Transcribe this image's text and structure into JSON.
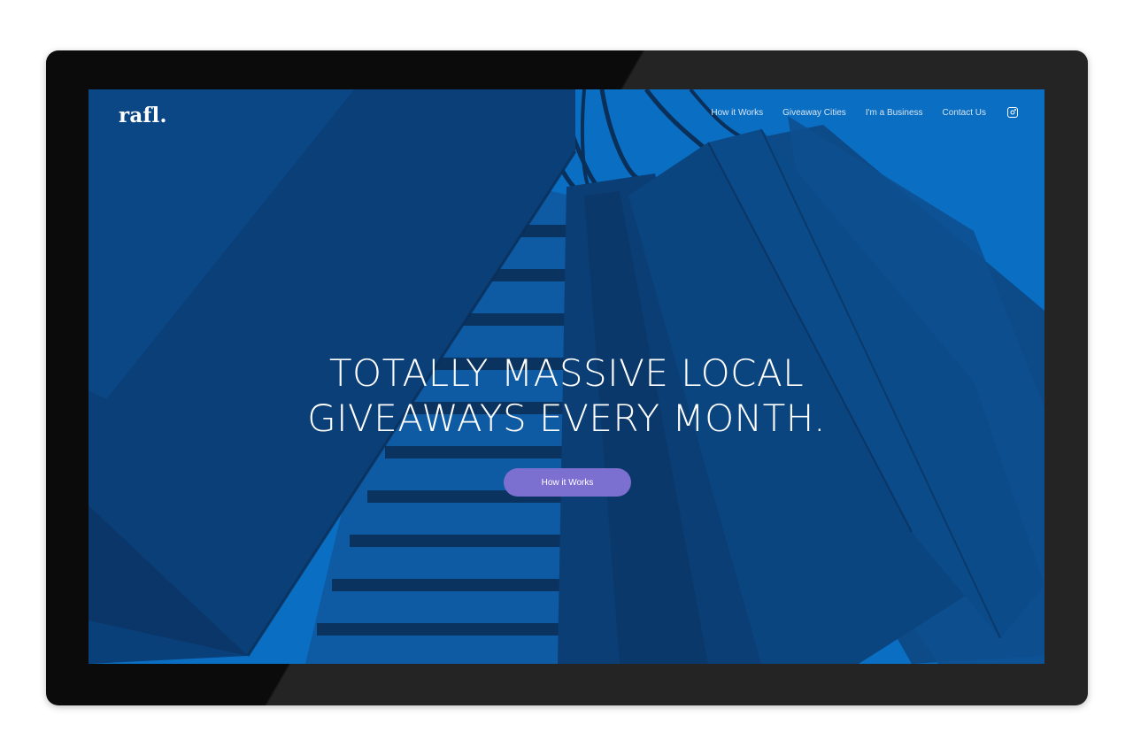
{
  "brand": {
    "logo_text": "rafl."
  },
  "nav": {
    "items": [
      {
        "label": "How it Works"
      },
      {
        "label": "Giveaway Cities"
      },
      {
        "label": "I'm a Business"
      },
      {
        "label": "Contact Us"
      }
    ],
    "social_icon": "instagram-icon"
  },
  "hero": {
    "headline_line1": "TOTALLY MASSIVE LOCAL",
    "headline_line2": "GIVEAWAYS EVERY MONTH.",
    "cta_label": "How it Works",
    "background_description_colors": {
      "base": "#0a6ec2",
      "bag_dark": "#0b3e74",
      "bag_mid": "#0d4f90",
      "accent_button": "#7b6fd0"
    }
  }
}
